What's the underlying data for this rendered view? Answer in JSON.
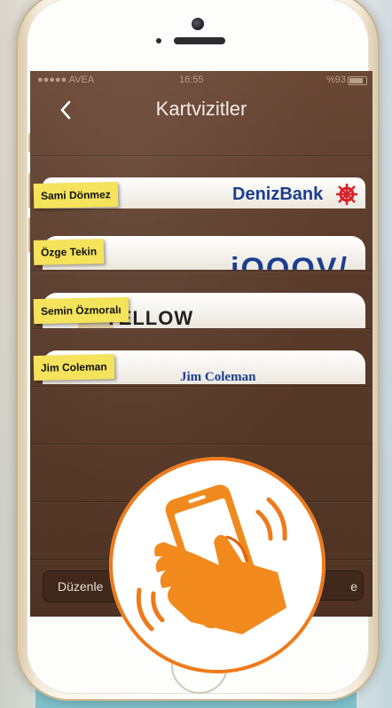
{
  "status_bar": {
    "carrier": "●●●●● AVEA",
    "time": "16:55",
    "battery": "%93"
  },
  "nav": {
    "back_icon": "chevron-left-icon",
    "title": "Kartvizitler"
  },
  "cards": [
    {
      "name": "Sami Dönmez",
      "brand": "DenizBank",
      "brand_color": "#1b3f8f"
    },
    {
      "name": "Özge Tekin",
      "brand": "iOOOV/",
      "brand_color": "#1b3f8f"
    },
    {
      "name": "Semin Özmoralı",
      "brand": "YELLOW",
      "brand_color": "#222222"
    },
    {
      "name": "Jim Coleman",
      "brand": "Jim Coleman",
      "brand_color": "#1b3f8f"
    }
  ],
  "toolbar": {
    "edit_label": "Düzenle",
    "right_label": "e"
  },
  "overlay": {
    "icon": "phone-shake-hand-icon",
    "accent": "#ef7a1a"
  }
}
